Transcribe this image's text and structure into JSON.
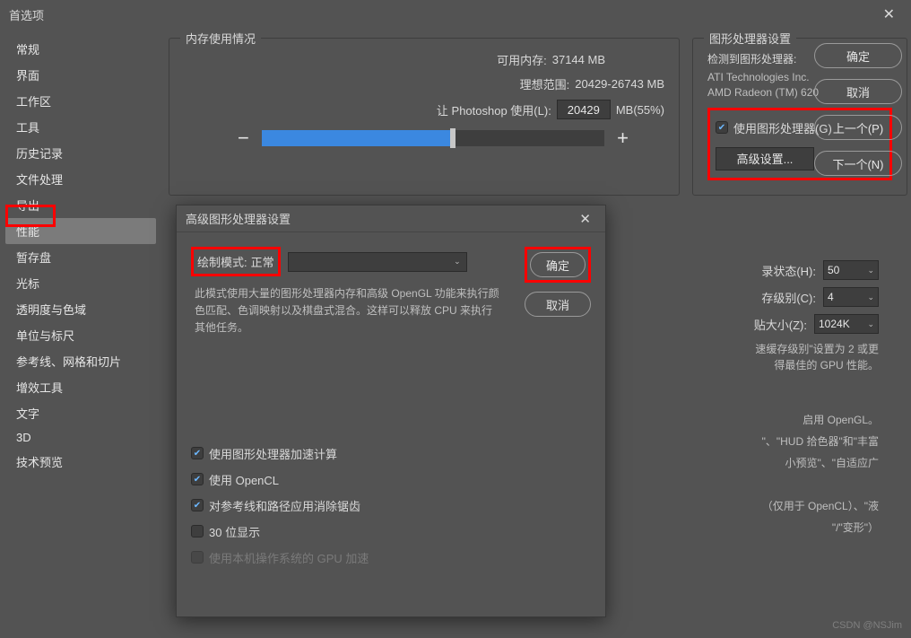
{
  "window": {
    "title": "首选项"
  },
  "sidebar": {
    "items": [
      "常规",
      "界面",
      "工作区",
      "工具",
      "历史记录",
      "文件处理",
      "导出",
      "性能",
      "暂存盘",
      "光标",
      "透明度与色域",
      "单位与标尺",
      "参考线、网格和切片",
      "增效工具",
      "文字",
      "3D",
      "技术预览"
    ],
    "active_index": 7
  },
  "buttons": {
    "ok": "确定",
    "cancel": "取消",
    "prev": "上一个(P)",
    "next": "下一个(N)"
  },
  "memory": {
    "title": "内存使用情况",
    "available_label": "可用内存:",
    "available_value": "37144 MB",
    "ideal_label": "理想范围:",
    "ideal_value": "20429-26743 MB",
    "let_label": "让 Photoshop 使用(L):",
    "let_value": "20429",
    "let_unit": "MB(55%)"
  },
  "gpu": {
    "title": "图形处理器设置",
    "detected_label": "检测到图形处理器:",
    "vendor": "ATI Technologies Inc.",
    "card": "AMD Radeon (TM) 620",
    "use_gpu_label": "使用图形处理器(G)",
    "advanced_btn": "高级设置..."
  },
  "history": {
    "hist_label": "录状态(H):",
    "hist_val": "50",
    "cache_label": "存级别(C):",
    "cache_val": "4",
    "tile_label": "贴大小(Z):",
    "tile_val": "1024K",
    "hint1": "速缓存级别\"设置为 2 或更",
    "hint2": "得最佳的 GPU 性能。"
  },
  "peek": {
    "l1": "启用 OpenGL。",
    "l2": "\"、\"HUD 拾色器\"和\"丰富",
    "l3": "小预览\"、\"自适应广",
    "l4": "（仅用于 OpenCL）、\"液",
    "l5": "\"/\"变形\"）"
  },
  "modal": {
    "title": "高级图形处理器设置",
    "mode_label": "绘制模式:",
    "mode_value": "正常",
    "desc": "此模式使用大量的图形处理器内存和高级 OpenGL 功能来执行颜色匹配、色调映射以及棋盘式混合。这样可以释放 CPU 来执行其他任务。",
    "ok": "确定",
    "cancel": "取消",
    "checks": {
      "accel": "使用图形处理器加速计算",
      "opencl": "使用 OpenCL",
      "antialias": "对参考线和路径应用消除锯齿",
      "bit30": "30 位显示",
      "native": "使用本机操作系统的 GPU 加速"
    }
  },
  "watermark": "CSDN @NSJim"
}
